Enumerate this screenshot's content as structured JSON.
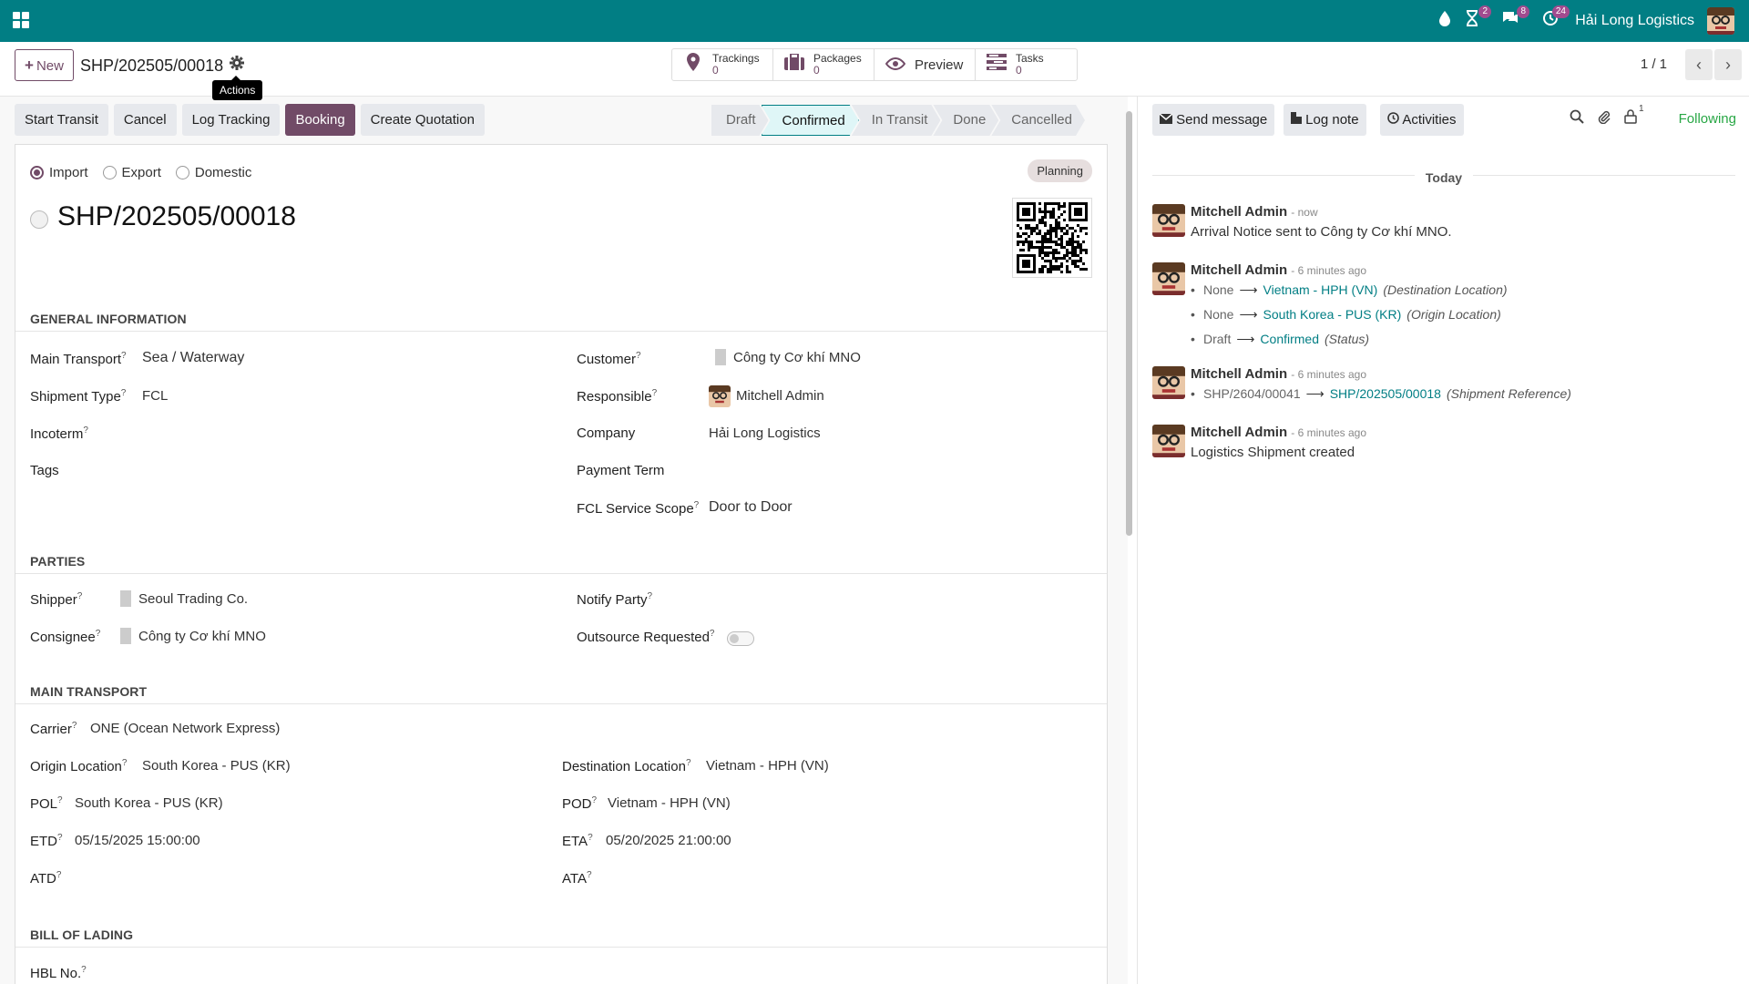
{
  "navbar": {
    "company": "Hải Long Logistics",
    "badges": {
      "activity": "2",
      "messages": "8",
      "clock": "24"
    },
    "icons": [
      "drop-icon",
      "hourglass-icon",
      "chat-icon",
      "clock-icon"
    ]
  },
  "control_panel": {
    "new_label": "New",
    "record_title": "SHP/202505/00018",
    "actions_tooltip": "Actions",
    "smart_buttons": [
      {
        "label": "Trackings",
        "count": "0"
      },
      {
        "label": "Packages",
        "count": "0"
      },
      {
        "label": "Preview"
      },
      {
        "label": "Tasks",
        "count": "0"
      }
    ],
    "pager": "1 / 1"
  },
  "statusbar": {
    "buttons": [
      "Start Transit",
      "Cancel",
      "Log Tracking",
      "Booking",
      "Create Quotation"
    ],
    "stages": [
      "Draft",
      "Confirmed",
      "In Transit",
      "Done",
      "Cancelled"
    ],
    "active_stage": "Confirmed"
  },
  "form": {
    "direction_options": [
      "Import",
      "Export",
      "Domestic"
    ],
    "selected_direction": "Import",
    "badge": "Planning",
    "name": "SHP/202505/00018",
    "general": {
      "title": "GENERAL INFORMATION",
      "main_transport_label": "Main Transport",
      "main_transport": "Sea / Waterway",
      "shipment_type_label": "Shipment Type",
      "shipment_type": "FCL",
      "incoterm_label": "Incoterm",
      "tags_label": "Tags",
      "customer_label": "Customer",
      "customer": "Công ty Cơ khí MNO",
      "responsible_label": "Responsible",
      "responsible": "Mitchell Admin",
      "company_label": "Company",
      "company": "Hải Long Logistics",
      "payment_term_label": "Payment Term",
      "fcl_scope_label": "FCL Service Scope",
      "fcl_scope": "Door to Door"
    },
    "parties": {
      "title": "PARTIES",
      "shipper_label": "Shipper",
      "shipper": "Seoul Trading Co.",
      "consignee_label": "Consignee",
      "consignee": "Công ty Cơ khí MNO",
      "notify_label": "Notify Party",
      "outsource_label": "Outsource Requested",
      "outsource": false
    },
    "transport": {
      "title": "MAIN TRANSPORT",
      "carrier_label": "Carrier",
      "carrier": "ONE (Ocean Network Express)",
      "origin_label": "Origin Location",
      "origin": "South Korea - PUS (KR)",
      "destination_label": "Destination Location",
      "destination": "Vietnam - HPH (VN)",
      "pol_label": "POL",
      "pol": "South Korea - PUS (KR)",
      "pod_label": "POD",
      "pod": "Vietnam - HPH (VN)",
      "etd_label": "ETD",
      "etd": "05/15/2025 15:00:00",
      "eta_label": "ETA",
      "eta": "05/20/2025 21:00:00",
      "atd_label": "ATD",
      "ata_label": "ATA"
    },
    "bol": {
      "title": "BILL OF LADING",
      "hbl_label": "HBL No."
    }
  },
  "chatter": {
    "send_message": "Send message",
    "log_note": "Log note",
    "activities": "Activities",
    "followers_count": "1",
    "following": "Following",
    "date_separator": "Today",
    "messages": [
      {
        "author": "Mitchell Admin",
        "time": "- now",
        "body": "Arrival Notice sent to Công ty Cơ khí MNO."
      },
      {
        "author": "Mitchell Admin",
        "time": "- 6 minutes ago",
        "tracking": [
          {
            "old": "None",
            "new": "Vietnam - HPH (VN)",
            "field": "(Destination Location)"
          },
          {
            "old": "None",
            "new": "South Korea - PUS (KR)",
            "field": "(Origin Location)"
          },
          {
            "old": "Draft",
            "new": "Confirmed",
            "field": "(Status)"
          }
        ]
      },
      {
        "author": "Mitchell Admin",
        "time": "- 6 minutes ago",
        "tracking": [
          {
            "old": "SHP/2604/00041",
            "new": "SHP/202505/00018",
            "field": "(Shipment Reference)"
          }
        ]
      },
      {
        "author": "Mitchell Admin",
        "time": "- 6 minutes ago",
        "body": "Logistics Shipment created"
      }
    ]
  },
  "colors": {
    "navbar": "#017e84",
    "primary": "#714b67",
    "link": "#017e84",
    "following": "#28a745"
  }
}
